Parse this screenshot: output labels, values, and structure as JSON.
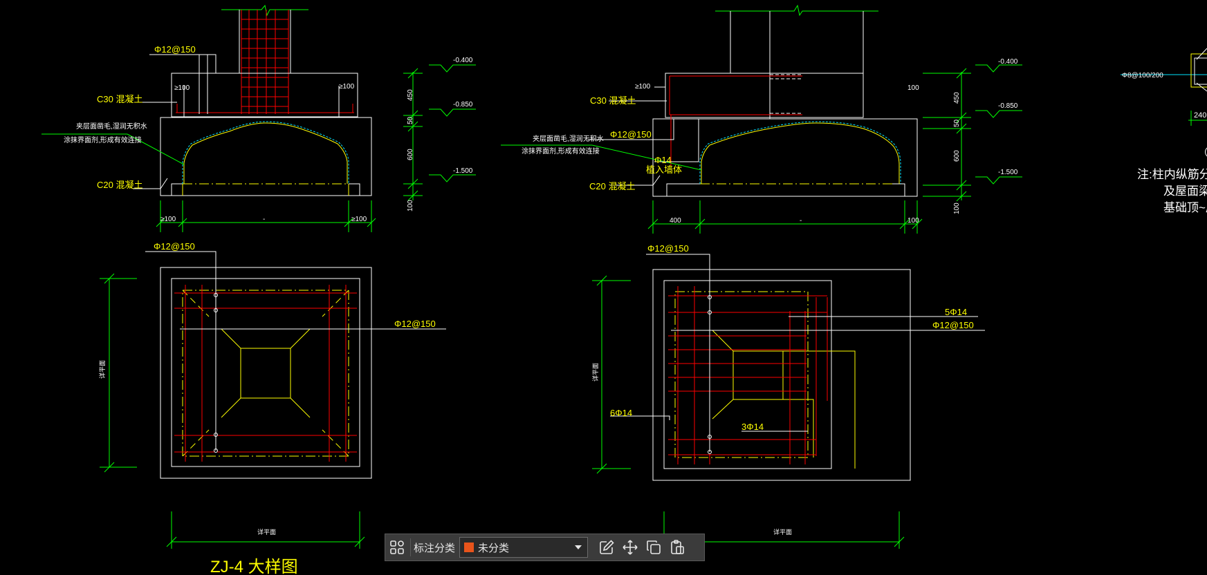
{
  "labels": {
    "ph150_a": "Φ12@150",
    "c30_a": "C30 混凝土",
    "c20_a": "C20 混凝土",
    "ge100": "≥100",
    "note1": "夹层面凿毛,湿润无积水",
    "note2": "涂抹界面剂,形成有效连接",
    "lvl_0400": "-0.400",
    "lvl_0850": "-0.850",
    "lvl_1500": "-1.500",
    "d450": "450",
    "d50": "50",
    "d600": "600",
    "d100": "100",
    "d400": "400",
    "dash": "-",
    "ph14": "Φ14",
    "plant_bar": "植入墙体",
    "bar_5phi14": "5Φ14",
    "bar_6phi14": "6Φ14",
    "bar_3phi14": "3Φ14",
    "side_label": "详平面",
    "drawing_title": "ZJ-4 大样图",
    "stirrup": "Φ8@100/200",
    "d240": "240",
    "note_r1": "注:柱内纵筋分别伸",
    "note_r2": "及屋面梁各",
    "note_r3": "基础顶~屋"
  },
  "toolbar": {
    "category_label": "标注分类",
    "category_value": "未分类",
    "category_color": "#e8541b"
  },
  "colors": {
    "background": "#000000",
    "concrete_outline": "#ffffff",
    "rebar": "#ff0000",
    "dimension": "#00ff00",
    "text": "#ffff00",
    "interface_line": "#00e5ff"
  },
  "icons": [
    "layout-grid-icon",
    "edit-icon",
    "move-icon",
    "copy-icon",
    "paste-icon"
  ]
}
